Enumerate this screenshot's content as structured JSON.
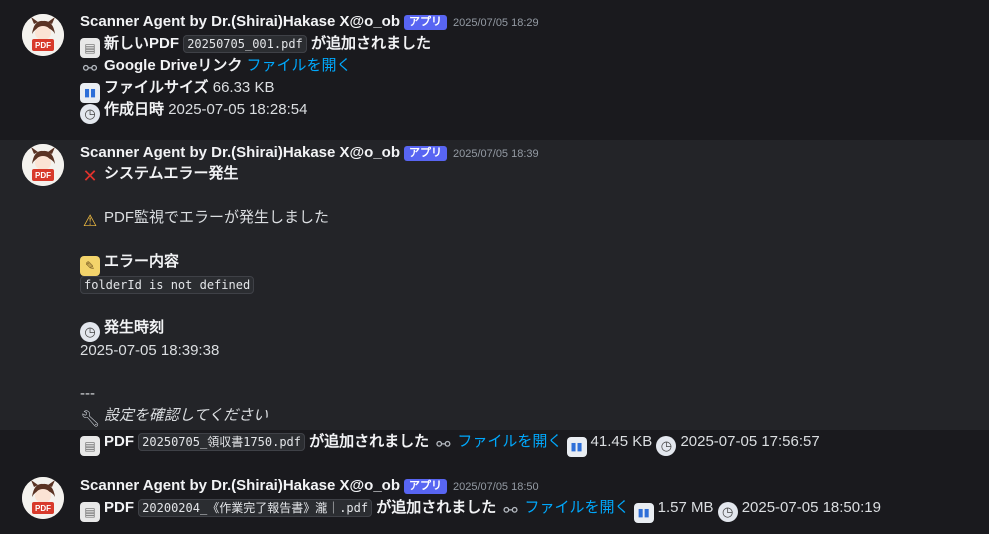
{
  "app": {
    "username": "Scanner Agent by Dr.(Shirai)Hakase X@o_ob",
    "badge": "アプリ",
    "avatar_label": "PDF"
  },
  "messages": [
    {
      "timestamp": "2025/07/05 18:29",
      "l1_pre": "新しいPDF",
      "l1_code": "20250705_001.pdf",
      "l1_post": "が追加されました",
      "l2_label": "Google Driveリンク",
      "l2_link": "ファイルを開く",
      "l3_label": "ファイルサイズ",
      "l3_val": "66.33 KB",
      "l4_label": "作成日時",
      "l4_val": "2025-07-05 18:28:54"
    },
    {
      "timestamp": "2025/07/05 18:39",
      "title": "システムエラー発生",
      "warn_text": "PDF監視でエラーが発生しました",
      "err_label": "エラー内容",
      "err_code": "folderId is not defined",
      "time_label": "発生時刻",
      "time_val": "2025-07-05 18:39:38",
      "sep": "---",
      "hint": "設定を確認してください"
    },
    {
      "pre": "PDF",
      "code": "20250705_領収書1750.pdf",
      "post": "が追加されました",
      "link": "ファイルを開く",
      "size": "41.45 KB",
      "date": "2025-07-05 17:56:57"
    },
    {
      "timestamp": "2025/07/05 18:50",
      "pre": "PDF",
      "code": "20200204_《作業完了報告書》瀧｜.pdf",
      "post": "が追加されました",
      "link": "ファイルを開く",
      "size": "1.57 MB",
      "date": "2025-07-05 18:50:19"
    }
  ],
  "icons": {
    "doc": "page-facing-up",
    "link": "link",
    "chart": "bar-chart",
    "clock": "clock",
    "cross": "cross-mark",
    "warn": "warning",
    "memo": "memo",
    "wrench": "wrench"
  },
  "colors": {
    "bg": "#1a1a1e",
    "highlight": "#232428",
    "link": "#00a8fc",
    "badge": "#5865f2"
  }
}
